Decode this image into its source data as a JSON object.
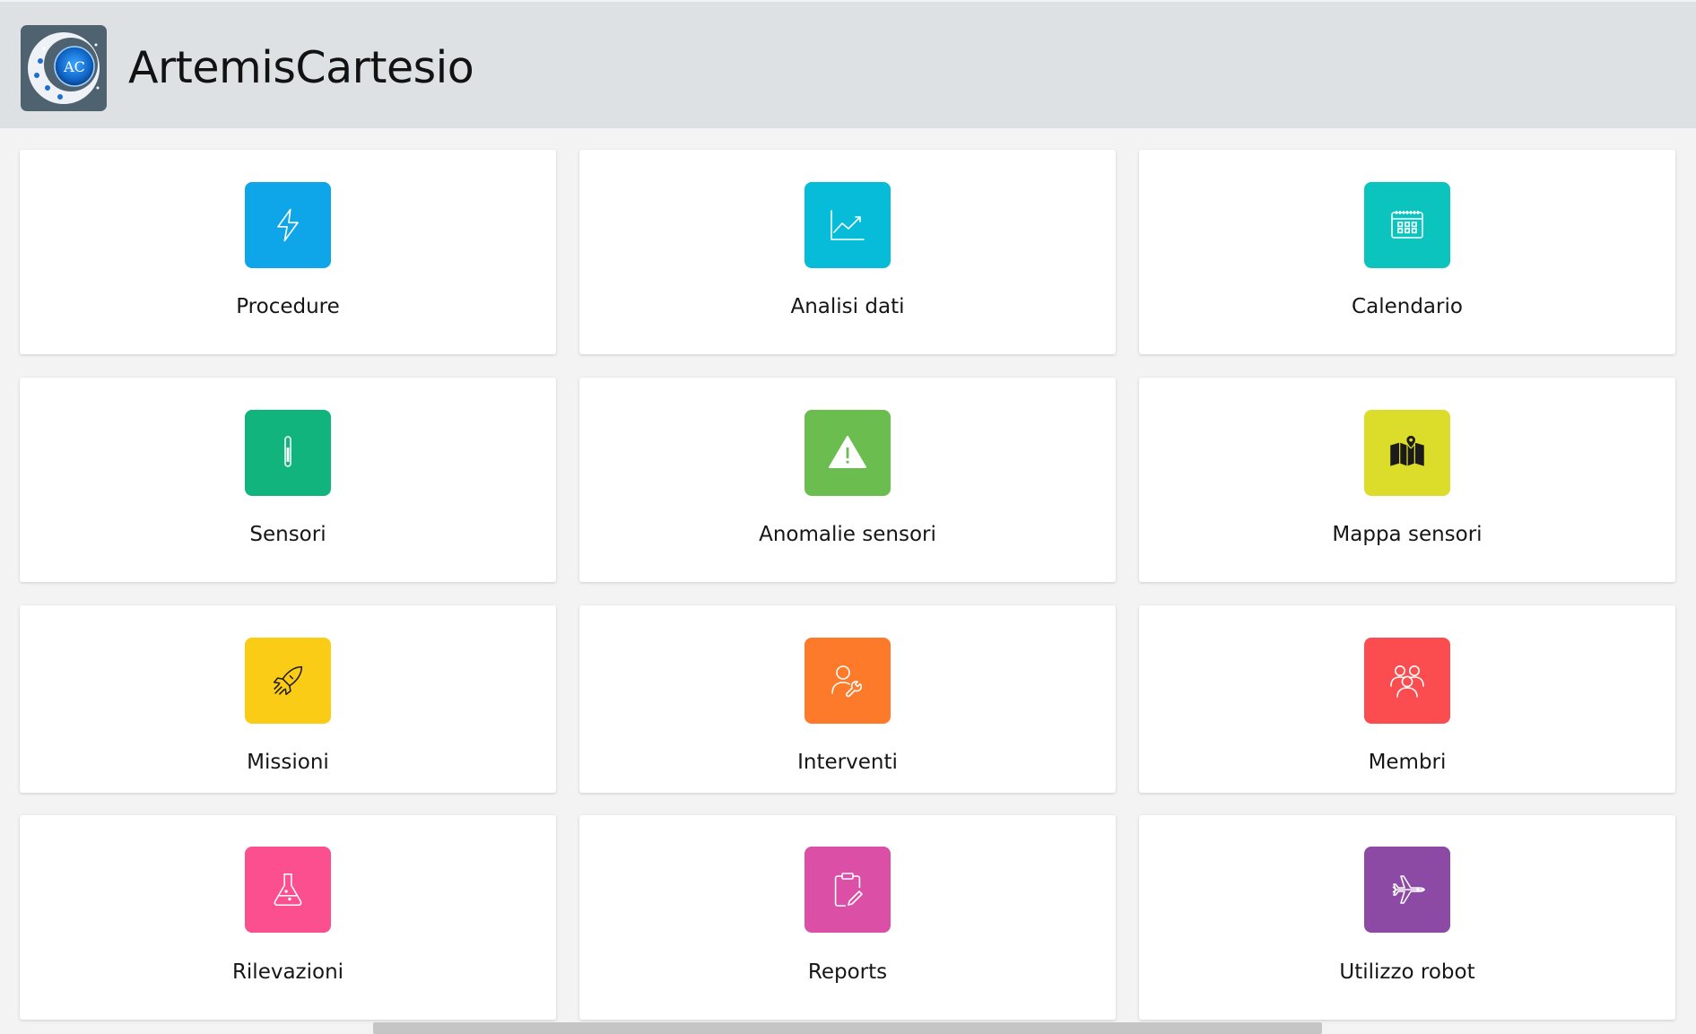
{
  "app": {
    "title": "ArtemisCartesio",
    "logo_text": "AC"
  },
  "tiles": [
    {
      "label": "Procedure",
      "icon": "lightning-icon",
      "color": "#0ea5e9"
    },
    {
      "label": "Analisi dati",
      "icon": "chart-line-icon",
      "color": "#06bcd8"
    },
    {
      "label": "Calendario",
      "icon": "calendar-icon",
      "color": "#0bc4bd"
    },
    {
      "label": "Sensori",
      "icon": "thermometer-icon",
      "color": "#12b47e"
    },
    {
      "label": "Anomalie sensori",
      "icon": "warning-icon",
      "color": "#6cbd4f"
    },
    {
      "label": "Mappa sensori",
      "icon": "map-pin-icon",
      "color": "#dcdc2b"
    },
    {
      "label": "Missioni",
      "icon": "rocket-icon",
      "color": "#facc15"
    },
    {
      "label": "Interventi",
      "icon": "user-wrench-icon",
      "color": "#fd7a2b"
    },
    {
      "label": "Membri",
      "icon": "users-icon",
      "color": "#fb4d50"
    },
    {
      "label": "Rilevazioni",
      "icon": "flask-icon",
      "color": "#fb4f8f"
    },
    {
      "label": "Reports",
      "icon": "clipboard-edit-icon",
      "color": "#db4fa6"
    },
    {
      "label": "Utilizzo robot",
      "icon": "jet-icon",
      "color": "#8c4aa5"
    }
  ]
}
